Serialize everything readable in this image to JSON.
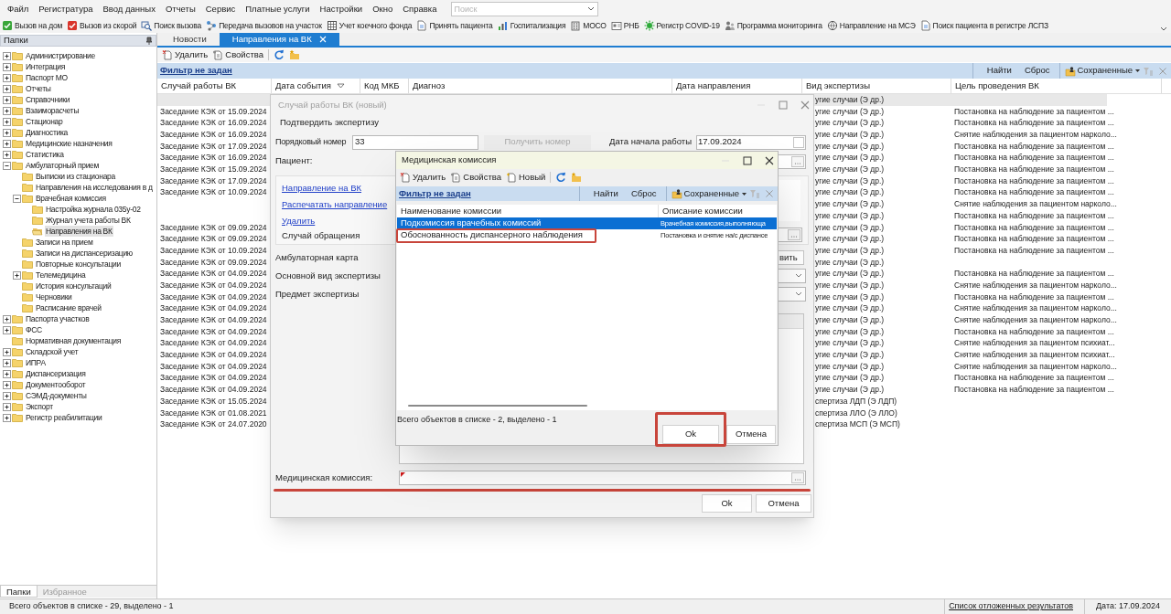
{
  "menu": [
    "Файл",
    "Регистратура",
    "Ввод данных",
    "Отчеты",
    "Сервис",
    "Платные услуги",
    "Настройки",
    "Окно",
    "Справка"
  ],
  "search": {
    "placeholder": "Поиск"
  },
  "toolbar": [
    "Вызов на дом",
    "Вызов из скорой",
    "Поиск вызова",
    "Передача вызовов на участок",
    "Учет коечного фонда",
    "Принять пациента",
    "Госпитализация",
    "МОСО",
    "РНБ",
    "Регистр COVID-19",
    "Программа мониторинга",
    "Направление на МСЭ",
    "Поиск пациента в регистре ЛСПЗ"
  ],
  "sidebar": {
    "title": "Папки",
    "items": [
      {
        "label": "Администрирование",
        "expanded": false,
        "selected": false
      },
      {
        "label": "Интеграция",
        "expanded": false,
        "selected": false
      },
      {
        "label": "Паспорт МО",
        "expanded": false,
        "selected": false
      },
      {
        "label": "Отчеты",
        "expanded": false,
        "selected": false
      },
      {
        "label": "Справочники",
        "expanded": false,
        "selected": false
      },
      {
        "label": "Взаиморасчеты",
        "expanded": false,
        "selected": false
      },
      {
        "label": "Стационар",
        "expanded": false,
        "selected": false
      },
      {
        "label": "Диагностика",
        "expanded": false,
        "selected": false
      },
      {
        "label": "Медицинские назначения",
        "expanded": false,
        "selected": false
      },
      {
        "label": "Статистика",
        "expanded": false,
        "selected": false
      },
      {
        "label": "Амбулаторный прием",
        "expanded": true,
        "selected": false,
        "children": [
          {
            "label": "Выписки из стационара",
            "selected": false
          },
          {
            "label": "Направления на исследования в д",
            "selected": false
          },
          {
            "label": "Врачебная комиссия",
            "expanded": true,
            "selected": false,
            "children": [
              {
                "label": "Настройка журнала 035у-02",
                "selected": false
              },
              {
                "label": "Журнал учета работы ВК",
                "selected": false
              },
              {
                "label": "Направления на ВК",
                "selected": true
              }
            ]
          },
          {
            "label": "Записи на прием",
            "selected": false
          },
          {
            "label": "Записи на диспансеризацию",
            "selected": false
          },
          {
            "label": "Повторные консультации",
            "selected": false
          },
          {
            "label": "Телемедицина",
            "expanded": false,
            "selected": false
          },
          {
            "label": "История консультаций",
            "selected": false
          },
          {
            "label": "Черновики",
            "selected": false
          },
          {
            "label": "Расписание врачей",
            "selected": false
          }
        ]
      },
      {
        "label": "Паспорта участков",
        "expanded": false,
        "selected": false
      },
      {
        "label": "ФСС",
        "expanded": false,
        "selected": false
      },
      {
        "label": "Нормативная документация",
        "selected": false
      },
      {
        "label": "Складской учет",
        "expanded": false,
        "selected": false
      },
      {
        "label": "ИПРА",
        "expanded": false,
        "selected": false
      },
      {
        "label": "Диспансеризация",
        "expanded": false,
        "selected": false
      },
      {
        "label": "Документооборот",
        "expanded": false,
        "selected": false
      },
      {
        "label": "СЭМД-документы",
        "expanded": false,
        "selected": false
      },
      {
        "label": "Экспорт",
        "expanded": false,
        "selected": false
      },
      {
        "label": "Регистр реабилитации",
        "expanded": false,
        "selected": false
      }
    ],
    "tabs": [
      {
        "label": "Папки",
        "selected": true
      },
      {
        "label": "Избранное",
        "selected": false
      }
    ]
  },
  "tabs": [
    {
      "label": "Новости",
      "selected": false
    },
    {
      "label": "Направления на ВК",
      "selected": true
    }
  ],
  "list_toolbar": [
    "Удалить",
    "Свойства"
  ],
  "filter": {
    "link": "Фильтр не задан",
    "buttons": [
      "Найти",
      "Сброс"
    ],
    "saved": "Сохраненные"
  },
  "table": {
    "columns": [
      {
        "label": "Случай работы ВК"
      },
      {
        "label": "Дата события",
        "sorted": true
      },
      {
        "label": "Код МКБ"
      },
      {
        "label": "Диагноз"
      },
      {
        "label": "Дата направления"
      },
      {
        "label": "Вид экспертизы"
      },
      {
        "label": "Цель проведения ВК"
      }
    ],
    "rows": [
      {
        "expertise": "угие случаи (Э др.)",
        "selected": true
      },
      {
        "case": "Заседание КЭК от 15.09.2024",
        "expertise": "угие случаи (Э др.)",
        "goal": "Постановка на наблюдение за пациентом ...",
        "selected": false
      },
      {
        "case": "Заседание КЭК от 16.09.2024",
        "expertise": "угие случаи (Э др.)",
        "goal": "Постановка на наблюдение за пациентом ...",
        "selected": false
      },
      {
        "case": "Заседание КЭК от 16.09.2024",
        "expertise": "угие случаи (Э др.)",
        "goal": "Снятие наблюдения за пациентом нарколо...",
        "selected": false
      },
      {
        "case": "Заседание КЭК от 17.09.2024",
        "expertise": "угие случаи (Э др.)",
        "goal": "Постановка на наблюдение за пациентом ...",
        "selected": false
      },
      {
        "case": "Заседание КЭК от 16.09.2024",
        "expertise": "угие случаи (Э др.)",
        "goal": "Постановка на наблюдение за пациентом ...",
        "selected": false
      },
      {
        "case": "Заседание КЭК от 15.09.2024",
        "expertise": "угие случаи (Э др.)",
        "goal": "Постановка на наблюдение за пациентом ...",
        "selected": false
      },
      {
        "case": "Заседание КЭК от 17.09.2024",
        "expertise": "угие случаи (Э др.)",
        "goal": "Постановка на наблюдение за пациентом ...",
        "selected": false
      },
      {
        "case": "Заседание КЭК от 10.09.2024",
        "expertise": "угие случаи (Э др.)",
        "goal": "Постановка на наблюдение за пациентом ...",
        "selected": false
      },
      {
        "expertise": "угие случаи (Э др.)",
        "goal": "Снятие наблюдения за пациентом нарколо...",
        "selected": false
      },
      {
        "expertise": "угие случаи (Э др.)",
        "goal": "Постановка на наблюдение за пациентом ...",
        "selected": false
      },
      {
        "case": "Заседание КЭК от 09.09.2024",
        "expertise": "угие случаи (Э др.)",
        "goal": "Постановка на наблюдение за пациентом ...",
        "selected": false
      },
      {
        "case": "Заседание КЭК от 09.09.2024",
        "expertise": "угие случаи (Э др.)",
        "goal": "Постановка на наблюдение за пациентом ...",
        "selected": false
      },
      {
        "case": "Заседание КЭК от 10.09.2024",
        "expertise": "угие случаи (Э др.)",
        "goal": "Постановка на наблюдение за пациентом ...",
        "selected": false
      },
      {
        "case": "Заседание КЭК от 09.09.2024",
        "expertise": "угие случаи (Э др.)",
        "selected": false
      },
      {
        "case": "Заседание КЭК от 04.09.2024",
        "expertise": "угие случаи (Э др.)",
        "goal": "Постановка на наблюдение за пациентом ...",
        "selected": false
      },
      {
        "case": "Заседание КЭК от 04.09.2024",
        "expertise": "угие случаи (Э др.)",
        "goal": "Снятие наблюдения за пациентом нарколо...",
        "selected": false
      },
      {
        "case": "Заседание КЭК от 04.09.2024",
        "expertise": "угие случаи (Э др.)",
        "goal": "Постановка на наблюдение за пациентом ...",
        "selected": false
      },
      {
        "case": "Заседание КЭК от 04.09.2024",
        "expertise": "угие случаи (Э др.)",
        "goal": "Снятие наблюдения за пациентом нарколо...",
        "selected": false
      },
      {
        "case": "Заседание КЭК от 04.09.2024",
        "expertise": "угие случаи (Э др.)",
        "goal": "Снятие наблюдения за пациентом нарколо...",
        "selected": false
      },
      {
        "case": "Заседание КЭК от 04.09.2024",
        "expertise": "угие случаи (Э др.)",
        "goal": "Постановка на наблюдение за пациентом ...",
        "selected": false
      },
      {
        "case": "Заседание КЭК от 04.09.2024",
        "expertise": "угие случаи (Э др.)",
        "goal": "Снятие наблюдения за пациентом психиат...",
        "selected": false
      },
      {
        "case": "Заседание КЭК от 04.09.2024",
        "expertise": "угие случаи (Э др.)",
        "goal": "Снятие наблюдения за пациентом психиат...",
        "selected": false
      },
      {
        "case": "Заседание КЭК от 04.09.2024",
        "expertise": "угие случаи (Э др.)",
        "goal": "Снятие наблюдения за пациентом нарколо...",
        "selected": false
      },
      {
        "case": "Заседание КЭК от 04.09.2024",
        "expertise": "угие случаи (Э др.)",
        "goal": "Постановка на наблюдение за пациентом ...",
        "selected": false
      },
      {
        "case": "Заседание КЭК от 04.09.2024",
        "expertise": "угие случаи (Э др.)",
        "goal": "Постановка на наблюдение за пациентом ...",
        "selected": false
      },
      {
        "case": "Заседание КЭК от 15.05.2024",
        "expertise": "спертиза ЛДП (Э ЛДП)",
        "selected": false
      },
      {
        "case": "Заседание КЭК от 01.08.2021",
        "expertise": "спертиза ЛЛО (Э ЛЛО)",
        "selected": false
      },
      {
        "case": "Заседание КЭК от 24.07.2020",
        "expertise": "спертиза МСП (Э МСП)",
        "selected": false
      }
    ]
  },
  "case_dialog": {
    "title": "Случай работы ВК (новый)",
    "confirm": "Подтвердить экспертизу",
    "number_label": "Порядковый номер",
    "number": "33",
    "get_number": {
      "label": "Получить номер",
      "disabled": true
    },
    "start_date_label": "Дата начала работы",
    "start_date": "17.09.2024",
    "patient_label": "Пациент:",
    "links": [
      "Направление на ВК",
      "Распечатать направление",
      "Удалить"
    ],
    "appeal_label": "Случай обращения",
    "card_label": "Амбулаторная карта",
    "card_button": "вить",
    "expertise_label": "Основной вид экспертизы",
    "subject_label": "Предмет экспертизы",
    "commission_label": "Медицинская комиссия:",
    "commission_required": true,
    "commission_underlined": true,
    "buttons": [
      "Ok",
      "Отмена"
    ]
  },
  "commission_dialog": {
    "title": "Медицинская комиссия",
    "toolbar": [
      "Удалить",
      "Свойства",
      "Новый"
    ],
    "filter": {
      "link": "Фильтр не задан",
      "buttons": [
        "Найти",
        "Сброс"
      ],
      "saved": "Сохраненные"
    },
    "columns": [
      "Наименование комиссии",
      "Описание комиссии"
    ],
    "rows": [
      {
        "name": "Подкомиссия врачебных комиссий",
        "description": "Врачебная комиссия,выполняюща",
        "selected": true,
        "highlighted": false
      },
      {
        "name": "Обоснованность диспансерного наблюдения",
        "description": "Постановка и снятие на/с диспансе",
        "selected": false,
        "highlighted": true
      }
    ],
    "status": "Всего объектов в списке - 2, выделено - 1",
    "ok": {
      "label": "Ok",
      "highlighted": true
    },
    "cancel": "Отмена"
  },
  "status_bar": {
    "text": "Всего объектов в списке - 29, выделено - 1",
    "link": "Список отложенных результатов",
    "date": "Дата: 17.09.2024"
  }
}
